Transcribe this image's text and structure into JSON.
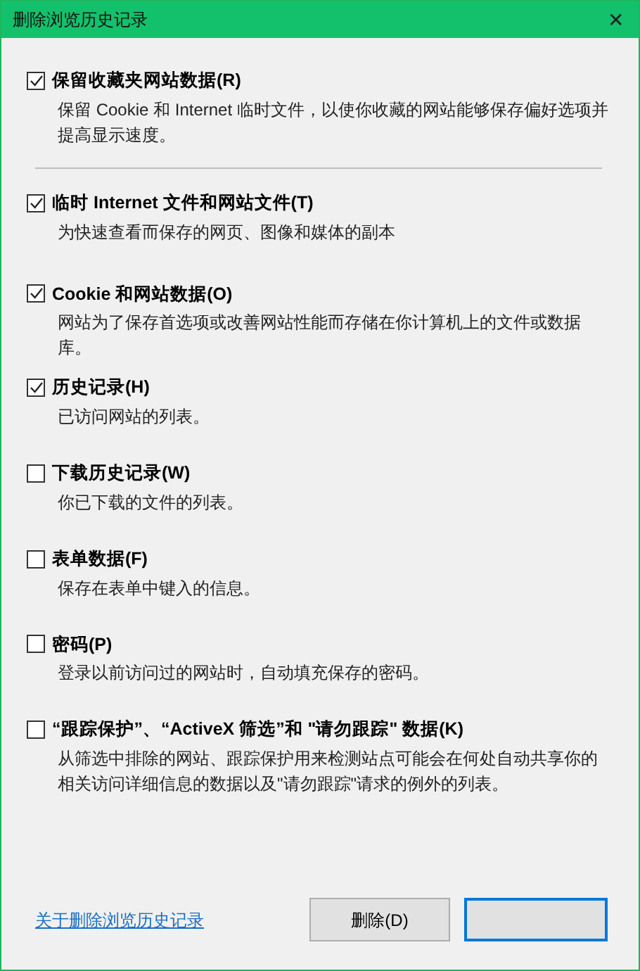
{
  "window": {
    "title": "删除浏览历史记录",
    "close": "✕"
  },
  "options": [
    {
      "label": "保留收藏夹网站数据(R)",
      "checked": true,
      "description": "保留 Cookie 和 Internet 临时文件，以使你收藏的网站能够保存偏好选项并提高显示速度。"
    },
    {
      "label": "临时 Internet 文件和网站文件(T)",
      "checked": true,
      "description": "为快速查看而保存的网页、图像和媒体的副本"
    },
    {
      "label": "Cookie 和网站数据(O)",
      "checked": true,
      "description": "网站为了保存首选项或改善网站性能而存储在你计算机上的文件或数据库。"
    },
    {
      "label": "历史记录(H)",
      "checked": true,
      "description": "已访问网站的列表。"
    },
    {
      "label": "下载历史记录(W)",
      "checked": false,
      "description": "你已下载的文件的列表。"
    },
    {
      "label": "表单数据(F)",
      "checked": false,
      "description": "保存在表单中键入的信息。"
    },
    {
      "label": "密码(P)",
      "checked": false,
      "description": "登录以前访问过的网站时，自动填充保存的密码。"
    },
    {
      "label": "“跟踪保护”、“ActiveX 筛选”和 \"请勿跟踪\" 数据(K)",
      "checked": false,
      "description": "从筛选中排除的网站、跟踪保护用来检测站点可能会在何处自动共享你的相关访问详细信息的数据以及\"请勿跟踪\"请求的例外的列表。"
    }
  ],
  "footer": {
    "link": "关于删除浏览历史记录",
    "delete_button": "删除(D)"
  }
}
